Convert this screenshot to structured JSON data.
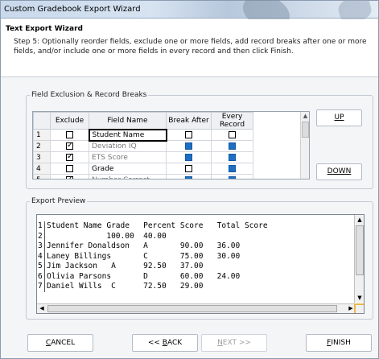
{
  "window": {
    "title": "Custom Gradebook Export Wizard"
  },
  "header": {
    "title": "Text Export Wizard",
    "description": "Step 5: Optionally reorder fields, exclude one or more fields, add record breaks after one or more fields, and/or include one or more fields in every record and then click Finish."
  },
  "field_exclusion": {
    "legend": "Field Exclusion & Record Breaks",
    "columns": [
      "Exclude",
      "Field Name",
      "Break After",
      "Every Record"
    ],
    "rows": [
      {
        "num": "1",
        "exclude": false,
        "name": "Student Name",
        "break_after": false,
        "every_record": false,
        "dimmed": false,
        "selected": true
      },
      {
        "num": "2",
        "exclude": true,
        "name": "Deviation IQ",
        "break_after": true,
        "every_record": true,
        "dimmed": true,
        "selected": false
      },
      {
        "num": "3",
        "exclude": true,
        "name": "ETS Score",
        "break_after": true,
        "every_record": true,
        "dimmed": true,
        "selected": false
      },
      {
        "num": "4",
        "exclude": false,
        "name": "Grade",
        "break_after": false,
        "every_record": true,
        "dimmed": false,
        "selected": false
      },
      {
        "num": "5",
        "exclude": true,
        "name": "Number Correct",
        "break_after": true,
        "every_record": true,
        "dimmed": true,
        "selected": false
      }
    ],
    "up_label": "UP",
    "down_label": "DOWN"
  },
  "export_preview": {
    "legend": "Export Preview",
    "lines": [
      {
        "num": "1",
        "text": "Student Name Grade   Percent Score   Total Score"
      },
      {
        "num": "2",
        "text": "             100.00  40.00"
      },
      {
        "num": "3",
        "text": "Jennifer Donaldson   A       90.00   36.00"
      },
      {
        "num": "4",
        "text": "Laney Billings       C       75.00   30.00"
      },
      {
        "num": "5",
        "text": "Jim Jackson   A      92.50   37.00"
      },
      {
        "num": "6",
        "text": "Olivia Parsons       D       60.00   24.00"
      },
      {
        "num": "7",
        "text": "Daniel Wills  C      72.50   29.00"
      }
    ]
  },
  "footer": {
    "cancel_label": "CANCEL",
    "back_label": "<< BACK",
    "next_label": "NEXT >>",
    "finish_label": "FINISH"
  }
}
